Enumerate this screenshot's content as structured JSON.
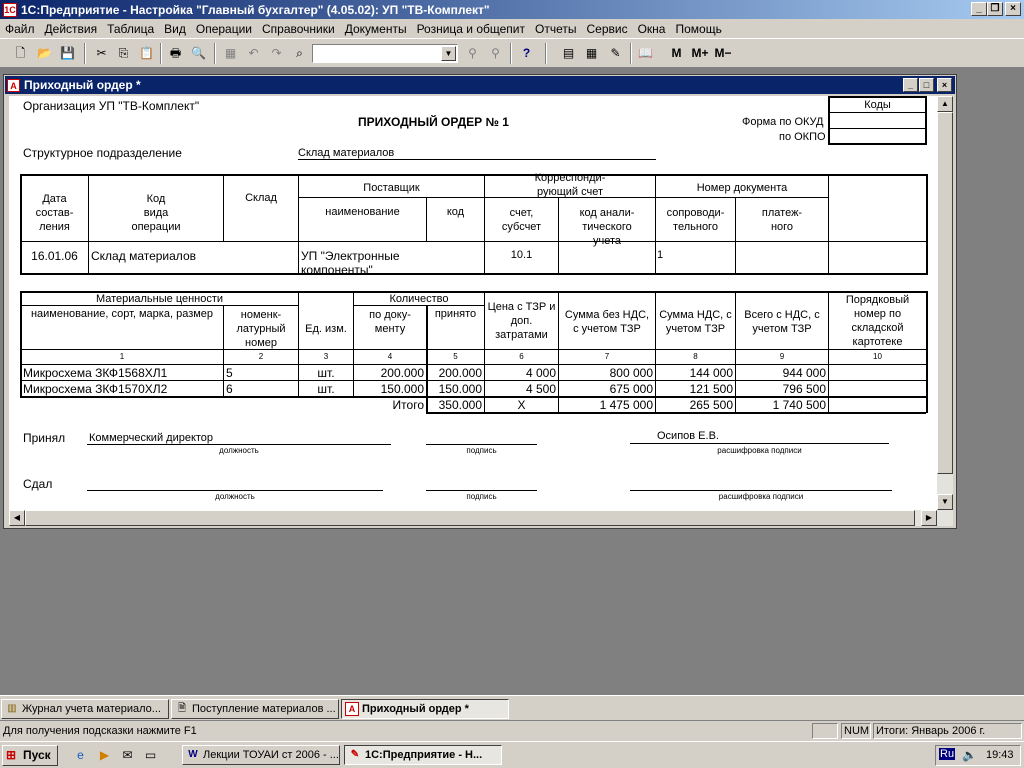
{
  "app": {
    "title": "1С:Предприятие - Настройка \"Главный бухгалтер\"  (4.05.02): УП \"ТВ-Комплект\"",
    "menu": [
      "Файл",
      "Действия",
      "Таблица",
      "Вид",
      "Операции",
      "Справочники",
      "Документы",
      "Розница и общепит",
      "Отчеты",
      "Сервис",
      "Окна",
      "Помощь"
    ],
    "toolbar_extra": {
      "m": "M",
      "m_plus": "M+",
      "m_minus": "M−"
    }
  },
  "doc_window": {
    "title": "Приходный ордер  *"
  },
  "form": {
    "org_label": "Организация УП \"ТВ-Комплект\"",
    "codes_header": "Коды",
    "okud_label": "Форма по ОКУД",
    "okpo_label": "по ОКПО",
    "heading": "ПРИХОДНЫЙ ОРДЕР № 1",
    "subdivision_label": "Структурное подразделение",
    "subdivision_value": "Склад материалов",
    "t1": {
      "date_h": [
        "Дата",
        "состав-",
        "ления"
      ],
      "optype_h": [
        "Код",
        "вида",
        "операции"
      ],
      "warehouse_h": "Склад",
      "supplier_h": "Поставщик",
      "supplier_name_h": "наименование",
      "supplier_code_h": "код",
      "corr_h": [
        "Корреспонди-",
        "рующий счет"
      ],
      "account_h": [
        "счет,",
        "субсчет"
      ],
      "analytic_h": [
        "код анали-",
        "тического",
        "учета"
      ],
      "docnum_h": "Номер документа",
      "accomp_h": [
        "сопроводи-",
        "тельного"
      ],
      "payment_h": [
        "платеж-",
        "ного"
      ],
      "row": {
        "date": "16.01.06",
        "optype": "Склад материалов",
        "supplier_name": [
          "УП \"Электронные",
          "компоненты\""
        ],
        "account": "10.1",
        "accomp": "1"
      }
    },
    "t2": {
      "mat_h": "Материальные ценности",
      "name_h": "наименование, сорт, марка, размер",
      "nomen_h": [
        "номенк-",
        "латурный",
        "номер"
      ],
      "unit_h": "Ед. изм.",
      "qty_h": "Количество",
      "bydoc_h": [
        "по доку-",
        "менту"
      ],
      "accepted_h": "принято",
      "price_h": [
        "Цена с ТЗР и",
        "доп.",
        "затратами"
      ],
      "sum_novat_h": [
        "Сумма без НДС,",
        "с учетом ТЗР"
      ],
      "vat_h": [
        "Сумма НДС, с",
        "учетом ТЗР"
      ],
      "total_h": [
        "Всего с НДС, с",
        "учетом ТЗР"
      ],
      "card_h": [
        "Порядковый",
        "номер по",
        "складской",
        "картотеке"
      ],
      "col_nums": [
        "1",
        "2",
        "3",
        "4",
        "5",
        "6",
        "7",
        "8",
        "9",
        "10"
      ],
      "rows": [
        {
          "name": "Микросхема ЗКФ1568ХЛ1",
          "nomen": "5",
          "unit": "шт.",
          "bydoc": "200.000",
          "accepted": "200.000",
          "price": "4 000",
          "sum": "800 000",
          "vat": "144 000",
          "total": "944 000"
        },
        {
          "name": "Микросхема ЗКФ1570ХЛ2",
          "nomen": "6",
          "unit": "шт.",
          "bydoc": "150.000",
          "accepted": "150.000",
          "price": "4 500",
          "sum": "675 000",
          "vat": "121 500",
          "total": "796 500"
        }
      ],
      "totals": {
        "label": "Итого",
        "bydoc": "350.000",
        "price": "Х",
        "sum": "1 475 000",
        "vat": "265 500",
        "total": "1 740 500"
      }
    },
    "sign": {
      "accepted_label": "Принял",
      "accepted_position": "Коммерческий директор",
      "accepted_name": "Осипов Е.В.",
      "handed_label": "Сдал",
      "position_caption": "должность",
      "signature_caption": "подпись",
      "decipher_caption": "расшифровка подписи"
    }
  },
  "taskwindows": [
    "Журнал учета материало...",
    "Поступление материалов ...",
    "Приходный ордер  *"
  ],
  "statusbar": {
    "hint": "Для получения подсказки нажмите F1",
    "num": "NUM",
    "totals": "Итоги: Январь 2006 г."
  },
  "taskbar": {
    "start": "Пуск",
    "items": [
      "Лекции ТОУАИ ст 2006 - ...",
      "1С:Предприятие - Н..."
    ],
    "lang": "Ru",
    "clock": "19:43"
  }
}
